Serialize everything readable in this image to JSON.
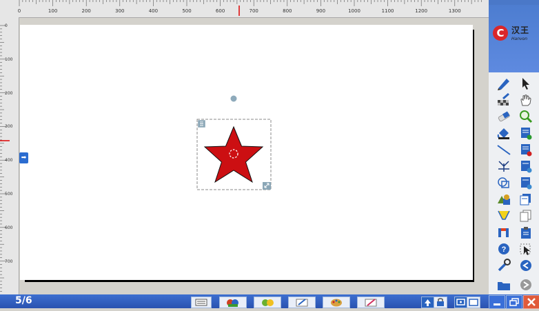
{
  "ruler": {
    "h_labels": [
      "0",
      "100",
      "200",
      "300",
      "400",
      "500",
      "600",
      "700",
      "800",
      "900",
      "1000",
      "1100",
      "1200",
      "1300"
    ],
    "v_labels": [
      "0",
      "100",
      "200",
      "300",
      "400",
      "500",
      "600",
      "700"
    ]
  },
  "logo": {
    "mark": "C",
    "text_cn": "汉王",
    "text_en": "Hanvon"
  },
  "page_indicator": "5/6",
  "star_color": "#cc0f12",
  "tools_left": [
    "pen-icon",
    "eraser-pattern-icon",
    "eraser-icon",
    "fill-bucket-icon",
    "line-icon",
    "axis-icon",
    "shape-recognition-icon",
    "shapes-icon",
    "highlighter-icon",
    "text-icon",
    "help-icon",
    "settings-wrench-icon",
    "folder-icon"
  ],
  "tools_right": [
    "select-arrow-icon",
    "hand-pan-icon",
    "zoom-icon",
    "new-page-icon",
    "delete-page-icon",
    "page-down-icon",
    "page-copy-icon",
    "copy-icon",
    "paste-icon",
    "cut-icon",
    "select-cursor-icon",
    "back-icon",
    "forward-icon"
  ],
  "taskbar_icons": [
    "keyboard-icon",
    "media-icon",
    "resource-icon",
    "note-icon",
    "palette-icon",
    "edit-icon",
    "upload-icon",
    "lock-icon",
    "screen-icon",
    "window-icon",
    "minimize-icon",
    "restore-icon",
    "close-icon"
  ]
}
